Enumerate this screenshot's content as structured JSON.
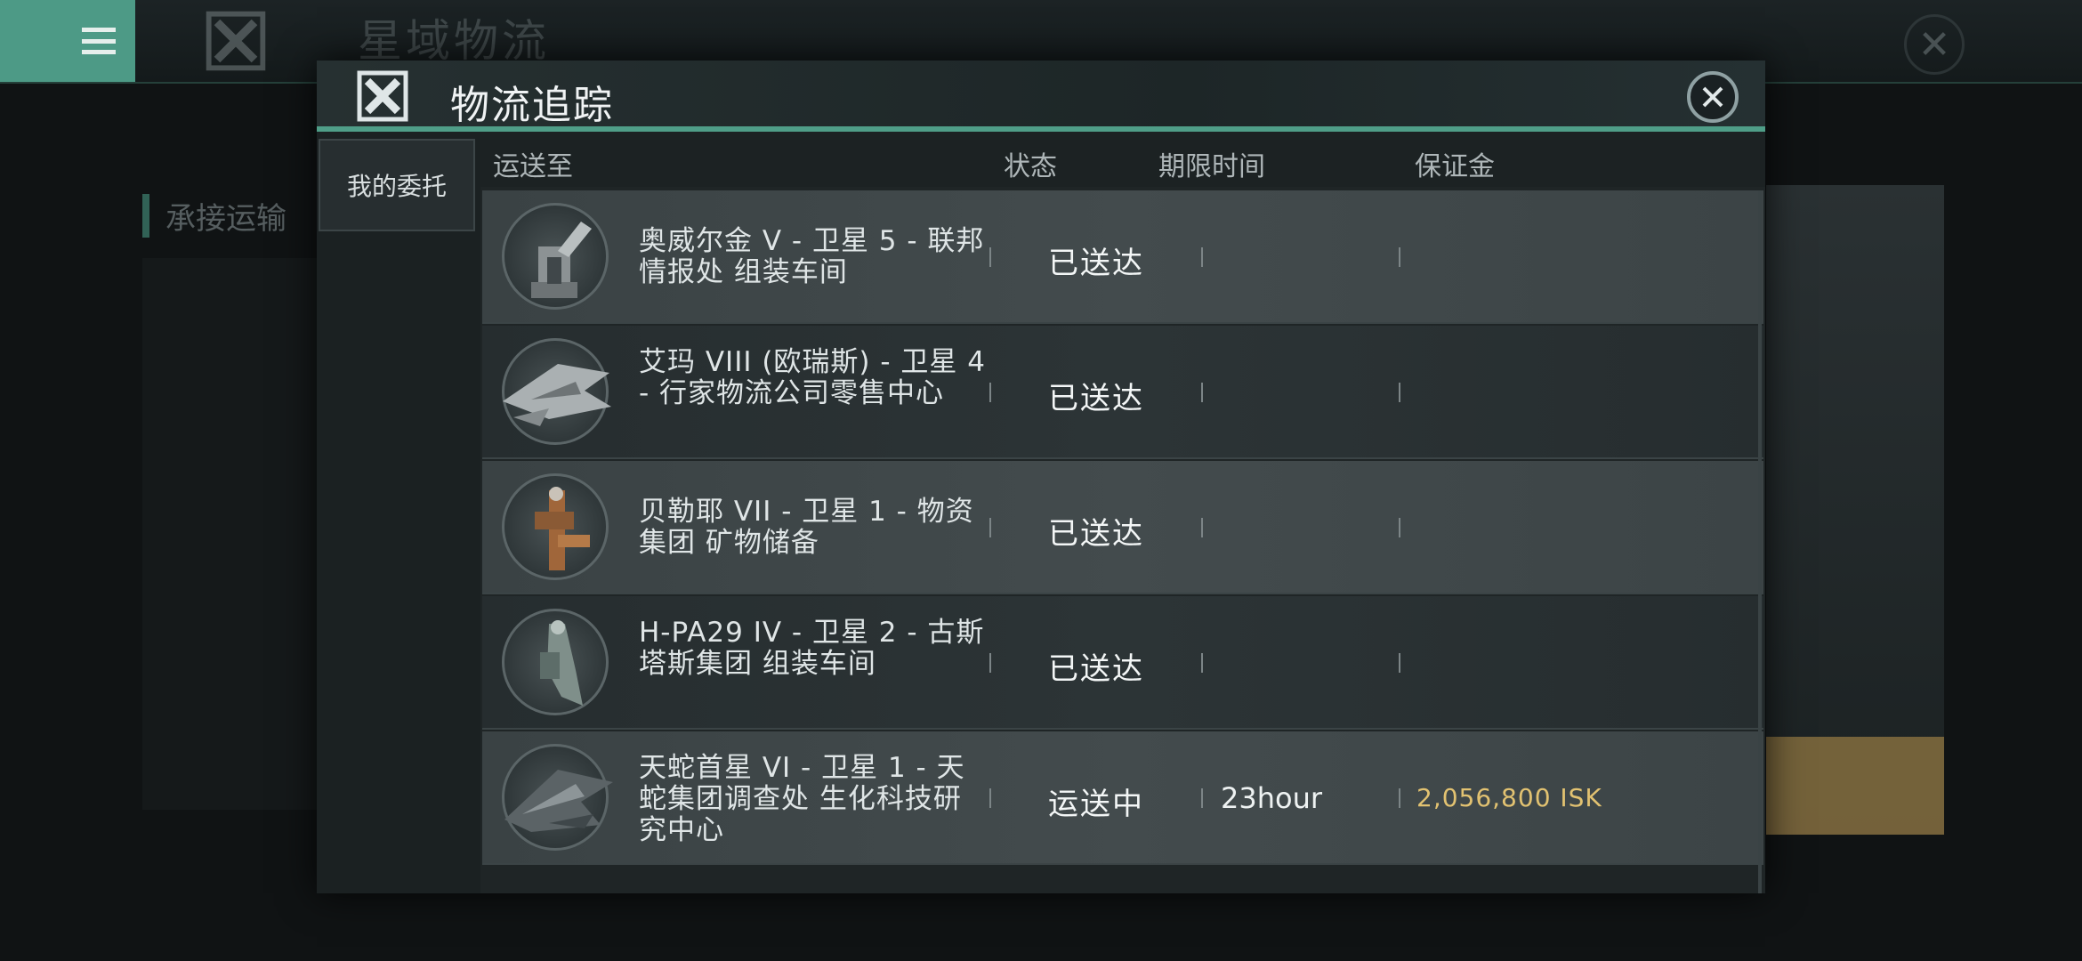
{
  "background": {
    "app_title": "星域物流",
    "section_title": "承接运输",
    "colors": {
      "accent": "#4d9a86",
      "gold": "#e2c271"
    }
  },
  "modal": {
    "title": "物流追踪",
    "side_tab": "我的委托",
    "columns": {
      "destination": "运送至",
      "status": "状态",
      "deadline": "期限时间",
      "deposit": "保证金"
    },
    "rows": [
      {
        "destination": "奥威尔金 V - 卫星 5 - 联邦情报处 组装车间",
        "status": "已送达",
        "deadline": "",
        "deposit": "",
        "ship_icon": "industrial-ship-icon"
      },
      {
        "destination": "艾玛 VIII (欧瑞斯) - 卫星 4 - 行家物流公司零售中心",
        "status": "已送达",
        "deadline": "",
        "deposit": "",
        "ship_icon": "amarr-ship-icon"
      },
      {
        "destination": "贝勒耶 VII - 卫星 1 - 物资集团 矿物储备",
        "status": "已送达",
        "deadline": "",
        "deposit": "",
        "ship_icon": "minmatar-ship-icon"
      },
      {
        "destination": "H-PA29 IV - 卫星 2 - 古斯塔斯集团 组装车间",
        "status": "已送达",
        "deadline": "",
        "deposit": "",
        "ship_icon": "gallente-ship-icon"
      },
      {
        "destination": "天蛇首星 VI - 卫星 1 - 天蛇集团调查处 生化科技研究中心",
        "status": "运送中",
        "deadline": "23hour",
        "deposit": "2,056,800 ISK",
        "ship_icon": "caldari-ship-icon"
      }
    ]
  }
}
